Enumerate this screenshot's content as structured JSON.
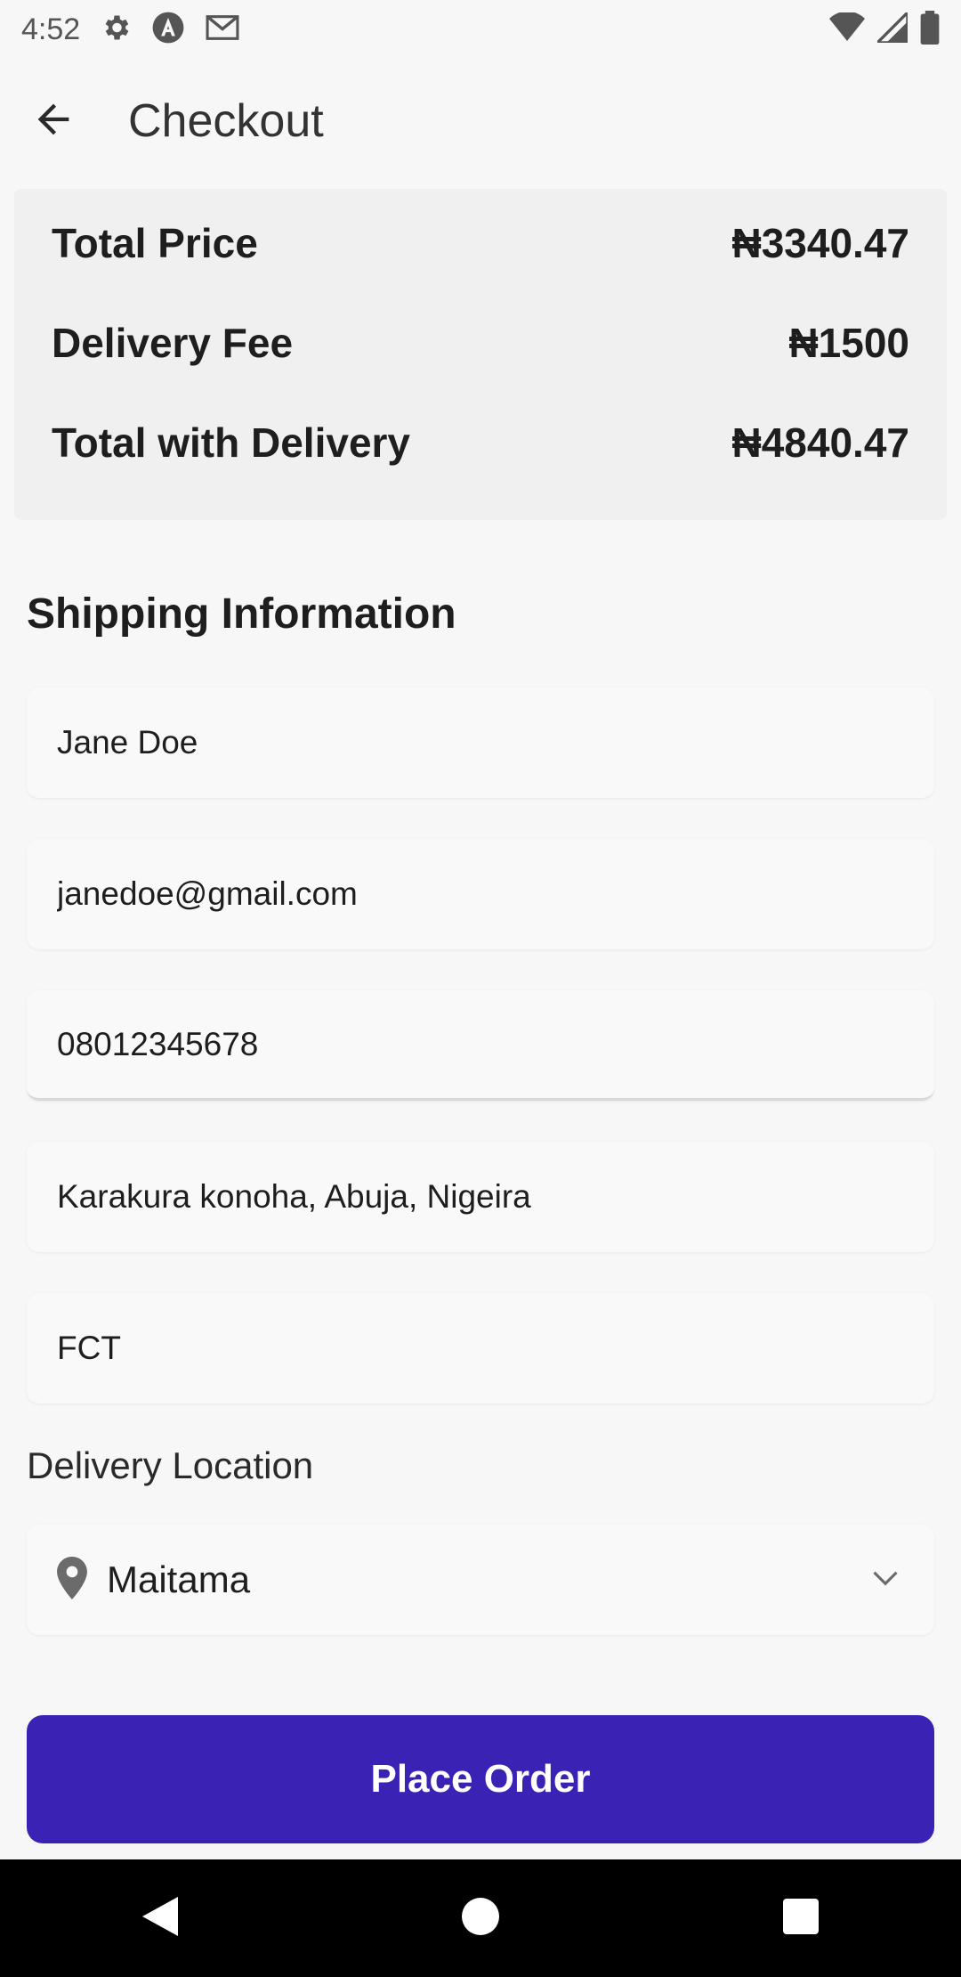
{
  "status_bar": {
    "time": "4:52",
    "left_icons": [
      "settings-icon",
      "a-circle-icon",
      "gmail-icon"
    ],
    "right_icons": [
      "wifi-icon",
      "signal-icon",
      "battery-icon"
    ]
  },
  "app_bar": {
    "title": "Checkout",
    "back_icon": "arrow-back-icon"
  },
  "summary": {
    "rows": [
      {
        "label": "Total Price",
        "value": "₦3340.47"
      },
      {
        "label": "Delivery Fee",
        "value": "₦1500"
      },
      {
        "label": "Total with Delivery",
        "value": "₦4840.47"
      }
    ]
  },
  "shipping": {
    "heading": "Shipping Information",
    "fields": [
      {
        "name": "name",
        "value": "Jane Doe"
      },
      {
        "name": "email",
        "value": "janedoe@gmail.com"
      },
      {
        "name": "phone",
        "value": "08012345678"
      },
      {
        "name": "address",
        "value": "Karakura konoha, Abuja, Nigeira"
      },
      {
        "name": "state",
        "value": "FCT"
      }
    ]
  },
  "delivery": {
    "label": "Delivery Location",
    "selected": "Maitama",
    "icon": "location-pin-icon"
  },
  "actions": {
    "place_order": "Place Order"
  },
  "colors": {
    "primary": "#3a22b5",
    "background": "#f7f7f7",
    "summary_bg": "#f0f0f0"
  }
}
